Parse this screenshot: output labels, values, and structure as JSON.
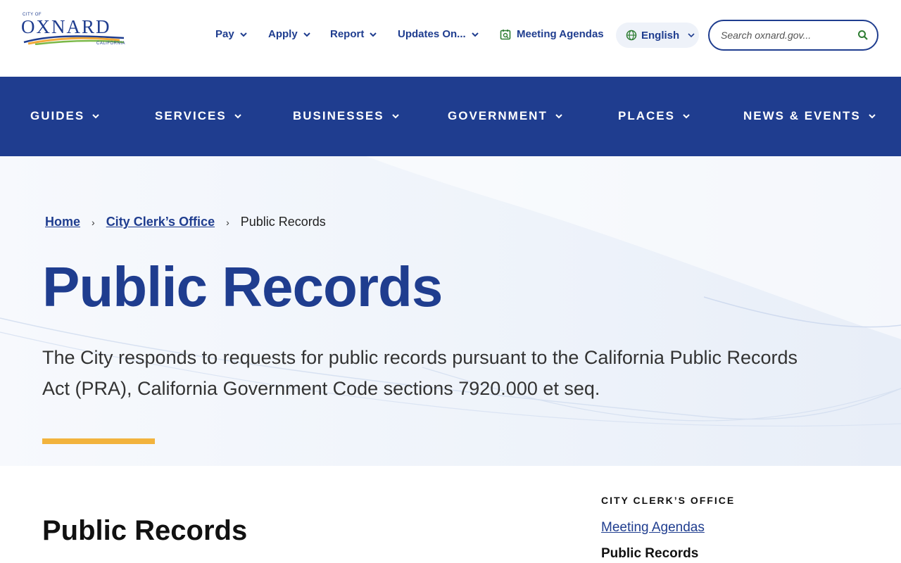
{
  "logo": {
    "top_text": "CITY OF",
    "name": "OXNARD",
    "sub_text": "CALIFORNIA"
  },
  "utility": {
    "pay": "Pay",
    "apply": "Apply",
    "report": "Report",
    "updates": "Updates On...",
    "meeting": "Meeting Agendas",
    "language": "English",
    "search_placeholder": "Search oxnard.gov..."
  },
  "nav": {
    "guides": "GUIDES",
    "services": "SERVICES",
    "businesses": "BUSINESSES",
    "government": "GOVERNMENT",
    "places": "PLACES",
    "news": "NEWS & EVENTS"
  },
  "breadcrumb": {
    "home": "Home",
    "clerk": "City Clerk’s Office",
    "current": "Public Records"
  },
  "hero": {
    "title": "Public Records",
    "lead": "The City responds to requests for public records pursuant to the California Public Records Act (PRA), California Government Code sections 7920.000 et seq."
  },
  "content": {
    "heading": "Public Records"
  },
  "sidebar": {
    "heading": "CITY CLERK’S OFFICE",
    "link": "Meeting Agendas",
    "current": "Public Records"
  },
  "colors": {
    "primary": "#1f3d8f",
    "accent": "#f2b33d",
    "logo_orange": "#f2a93b",
    "logo_green": "#7bb847"
  },
  "icons": {
    "chevron": "chevron-down-icon",
    "calendar": "calendar-check-icon",
    "globe": "globe-icon",
    "search": "search-icon",
    "breadcrumb_sep": "chevron-right-icon"
  }
}
